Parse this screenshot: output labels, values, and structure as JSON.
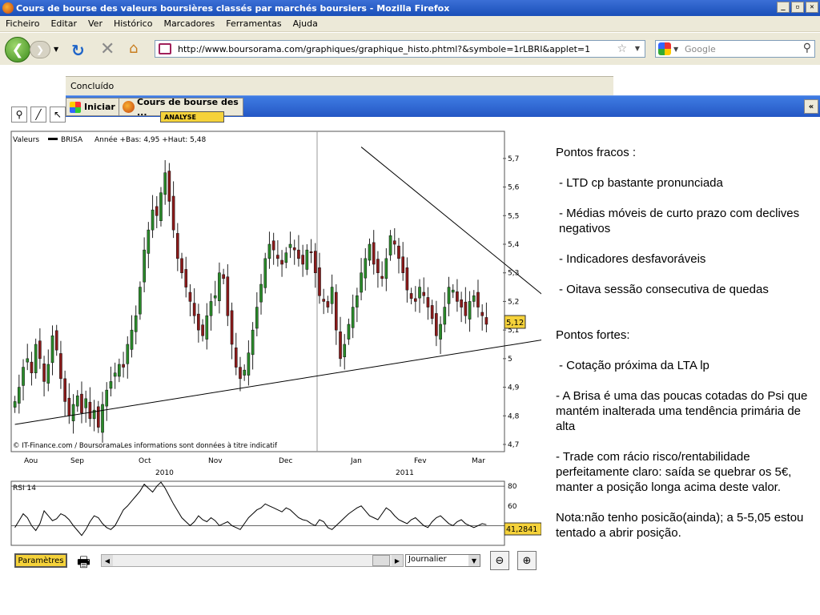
{
  "window": {
    "title": "Cours de bourse des valeurs boursières classés par marchés boursiers - Mozilla Firefox",
    "buttons": [
      "_",
      "▫",
      "✕"
    ]
  },
  "menu": [
    "Ficheiro",
    "Editar",
    "Ver",
    "Histórico",
    "Marcadores",
    "Ferramentas",
    "Ajuda"
  ],
  "navigation": {
    "url": "http://www.boursorama.com/graphiques/graphique_histo.phtml?&symbole=1rLBRI&applet=1",
    "search_placeholder": "Google"
  },
  "status": {
    "text": "Concluído"
  },
  "taskbar": {
    "start_label": "Iniciar",
    "task_label": "Cours de bourse des ...",
    "chevron": "«"
  },
  "chart_toolbar": {
    "analyse_label": "ANALYSE"
  },
  "colors": {
    "up_candle": "#2a8a2a",
    "down_candle": "#8b1a1a",
    "price_badge": "#f5d23a"
  },
  "chart_data": [
    {
      "type": "candlestick",
      "legend": {
        "prefix": "Valeurs",
        "series": "BRISA",
        "info": "Année +Bas: 4,95 +Haut: 5,48"
      },
      "current_value_label": "5,12",
      "ylim": [
        4.7,
        5.75
      ],
      "y_ticks": [
        "5,7",
        "5,6",
        "5,5",
        "5,4",
        "5,3",
        "5,2",
        "5,1",
        "5",
        "4,9",
        "4,8",
        "4,7"
      ],
      "x_months": [
        "Aou",
        "Sep",
        "Oct",
        "Nov",
        "Dec",
        "Jan",
        "Fev",
        "Mar"
      ],
      "x_years": [
        "2010",
        "2011"
      ],
      "footer": "© IT-Finance.com / BoursoramaLes informations sont données à titre indicatif",
      "closes": [
        4.85,
        4.9,
        4.97,
        5.0,
        4.95,
        5.05,
        5.0,
        4.92,
        4.98,
        5.08,
        5.03,
        4.93,
        4.85,
        4.8,
        4.84,
        4.87,
        4.81,
        4.86,
        4.79,
        4.82,
        4.76,
        4.84,
        4.89,
        4.92,
        4.95,
        4.98,
        4.97,
        5.05,
        5.1,
        5.15,
        5.25,
        5.38,
        5.45,
        5.52,
        5.5,
        5.58,
        5.65,
        5.55,
        5.45,
        5.35,
        5.3,
        5.25,
        5.2,
        5.15,
        5.1,
        5.08,
        5.15,
        5.2,
        5.22,
        5.3,
        5.28,
        5.15,
        5.05,
        4.97,
        4.93,
        4.96,
        5.02,
        5.1,
        5.18,
        5.26,
        5.35,
        5.4,
        5.38,
        5.35,
        5.33,
        5.37,
        5.4,
        5.38,
        5.35,
        5.33,
        5.38,
        5.37,
        5.3,
        5.22,
        5.2,
        5.18,
        5.25,
        5.1,
        5.0,
        5.05,
        5.12,
        5.18,
        5.22,
        5.3,
        5.35,
        5.4,
        5.33,
        5.3,
        5.28,
        5.35,
        5.43,
        5.4,
        5.35,
        5.3,
        5.24,
        5.21,
        5.2,
        5.25,
        5.22,
        5.18,
        5.14,
        5.08,
        5.12,
        5.18,
        5.25,
        5.24,
        5.2,
        5.18,
        5.15,
        5.2,
        5.22,
        5.18,
        5.15,
        5.12
      ],
      "trendlines": [
        {
          "name": "descending",
          "points": [
            [
              83,
              5.74
            ],
            [
              133,
              5.1
            ]
          ]
        },
        {
          "name": "ascending",
          "points": [
            [
              0,
              4.77
            ],
            [
              133,
              5.09
            ]
          ]
        }
      ]
    },
    {
      "type": "line",
      "legend": "RSI 14",
      "current_value_label": "41,2841",
      "ylim": [
        0,
        100
      ],
      "y_ticks": [
        "80",
        "60",
        "40"
      ],
      "values": [
        38,
        45,
        52,
        48,
        40,
        35,
        42,
        55,
        50,
        45,
        47,
        52,
        50,
        46,
        40,
        35,
        30,
        36,
        44,
        50,
        48,
        42,
        38,
        36,
        40,
        48,
        56,
        60,
        65,
        70,
        75,
        82,
        78,
        74,
        80,
        84,
        78,
        70,
        62,
        55,
        48,
        44,
        40,
        44,
        50,
        46,
        44,
        48,
        45,
        40,
        42,
        44,
        40,
        38,
        36,
        42,
        48,
        52,
        56,
        58,
        62,
        60,
        58,
        56,
        54,
        58,
        56,
        52,
        48,
        46,
        45,
        42,
        40,
        46,
        44,
        38,
        36,
        40,
        44,
        48,
        52,
        55,
        58,
        60,
        55,
        50,
        48,
        46,
        52,
        58,
        55,
        50,
        46,
        44,
        42,
        46,
        48,
        44,
        40,
        38,
        44,
        48,
        50,
        46,
        42,
        40,
        44,
        46,
        42,
        40,
        38,
        40,
        42,
        41
      ]
    }
  ],
  "bottom_controls": {
    "params_label": "Paramètres",
    "period_select": "Journalier"
  },
  "notes": {
    "weak_title": "Pontos fracos :",
    "weak": [
      "- LTD cp bastante pronunciada",
      "- Médias móveis de curto prazo com declives negativos",
      "- Indicadores desfavoráveis",
      "- Oitava sessão consecutiva de quedas"
    ],
    "strong_title": "Pontos fortes:",
    "strong": [
      "- Cotação próxima da LTA lp",
      "- A Brisa é uma das poucas cotadas do Psi que mantém inalterada uma tendência primária de alta",
      "- Trade com rácio risco/rentabilidade perfeitamente claro: saída se quebrar os 5€, manter a posição longa acima deste valor."
    ],
    "note": "Nota:não tenho posicão(ainda); a 5-5,05 estou tentado a abrir posição."
  }
}
